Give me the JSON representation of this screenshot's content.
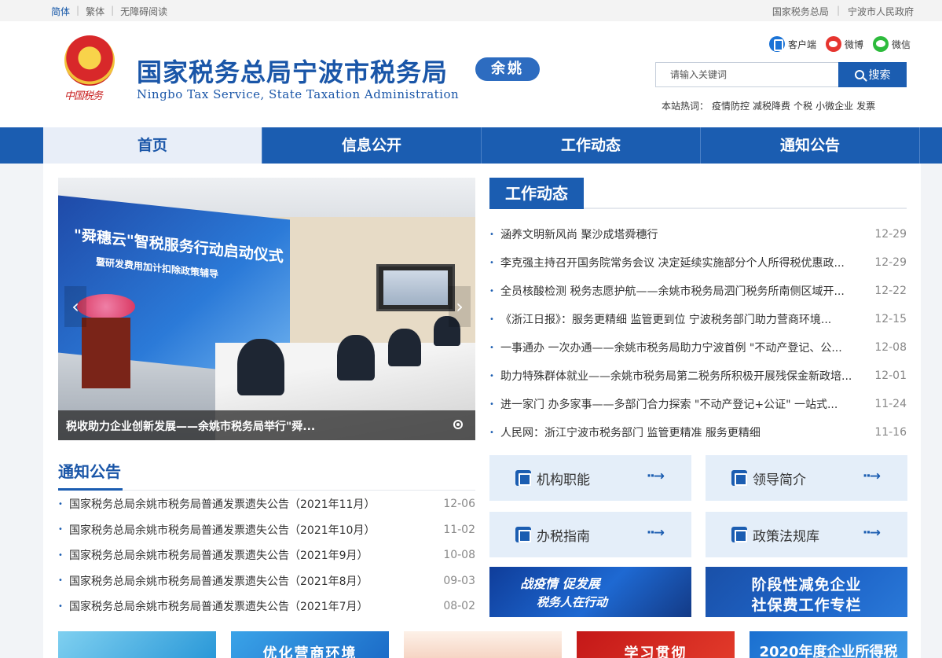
{
  "topbar": {
    "lang_simplified": "简体",
    "lang_traditional": "繁体",
    "accessible": "无障碍阅读",
    "link_state": "国家税务总局",
    "link_gov": "宁波市人民政府"
  },
  "header": {
    "emblem_text": "中国税务",
    "title": "国家税务总局宁波市税务局",
    "branch": "余姚",
    "subtitle": "Ningbo Tax Service, State Taxation Administration",
    "social": {
      "client": "客户端",
      "weibo": "微博",
      "wechat": "微信"
    },
    "search": {
      "placeholder": "请输入关键词",
      "button": "搜索"
    },
    "hot": {
      "label": "本站热词：",
      "keywords": [
        "疫情防控",
        "减税降费",
        "个税",
        "小微企业",
        "发票"
      ]
    }
  },
  "nav": {
    "tabs": [
      "首页",
      "信息公开",
      "工作动态",
      "通知公告"
    ],
    "active_index": 0
  },
  "carousel": {
    "screen_title": "\"舜穗云\"智税服务行动启动仪式",
    "screen_sub": "暨研发费用加计扣除政策辅导",
    "caption": "税收助力企业创新发展——余姚市税务局举行\"舜..."
  },
  "work_news": {
    "title": "工作动态",
    "items": [
      {
        "text": "涵养文明新风尚 聚沙成塔舜穗行",
        "date": "12-29"
      },
      {
        "text": "李克强主持召开国务院常务会议 决定延续实施部分个人所得税优惠政...",
        "date": "12-29"
      },
      {
        "text": "全员核酸检测 税务志愿护航——余姚市税务局泗门税务所南侧区域开...",
        "date": "12-22"
      },
      {
        "text": "《浙江日报》：服务更精细 监管更到位 宁波税务部门助力营商环境...",
        "date": "12-15"
      },
      {
        "text": "一事通办 一次办通——余姚市税务局助力宁波首例 \"不动产登记、公...",
        "date": "12-08"
      },
      {
        "text": "助力特殊群体就业——余姚市税务局第二税务所积极开展残保金新政培...",
        "date": "12-01"
      },
      {
        "text": "进一家门 办多家事——多部门合力探索 \"不动产登记+公证\" 一站式...",
        "date": "11-24"
      },
      {
        "text": "人民网：浙江宁波市税务部门 监管更精准 服务更精细",
        "date": "11-16"
      }
    ]
  },
  "notices": {
    "title": "通知公告",
    "items": [
      {
        "text": "国家税务总局余姚市税务局普通发票遗失公告（2021年11月）",
        "date": "12-06"
      },
      {
        "text": "国家税务总局余姚市税务局普通发票遗失公告（2021年10月）",
        "date": "11-02"
      },
      {
        "text": "国家税务总局余姚市税务局普通发票遗失公告（2021年9月）",
        "date": "10-08"
      },
      {
        "text": "国家税务总局余姚市税务局普通发票遗失公告（2021年8月）",
        "date": "09-03"
      },
      {
        "text": "国家税务总局余姚市税务局普通发票遗失公告（2021年7月）",
        "date": "08-02"
      }
    ]
  },
  "quick_links": {
    "org": "机构职能",
    "leaders": "领导简介",
    "guide": "办税指南",
    "policy": "政策法规库",
    "arrow": "··→"
  },
  "banners": {
    "b1_line1": "战疫情 促发展",
    "b1_line2": "税务人在行动",
    "b2_line1": "阶段性减免企业",
    "b2_line2": "社保费工作专栏"
  },
  "strip": {
    "s2": "优化营商环境",
    "s4": "学习贯彻",
    "s5": "2020年度企业所得税"
  },
  "colors": {
    "brand_blue": "#1b5db1",
    "nav_active_bg": "#e8eef8",
    "quick_bg": "#e4eef9"
  }
}
